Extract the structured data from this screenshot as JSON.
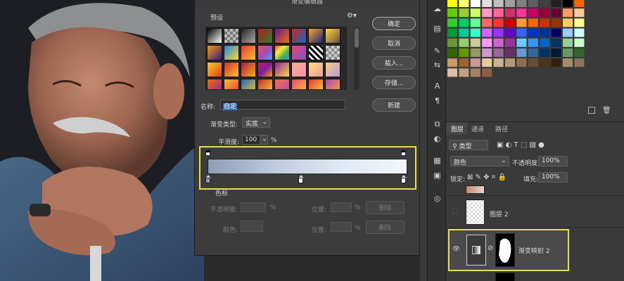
{
  "dialog": {
    "title": "渐变编辑器",
    "presets_label": "预设",
    "name_label": "名称:",
    "name_value": "自定",
    "gradient_type_label": "渐变类型:",
    "gradient_type_value": "实底",
    "smoothness_label": "平滑度:",
    "smoothness_value": "100",
    "smoothness_unit": "%",
    "stops_section_label": "色标",
    "opacity_label": "不透明度:",
    "opacity_unit": "%",
    "location_label": "位置:",
    "location_unit": "%",
    "delete_label": "删除",
    "color_label": "颜色:",
    "buttons": {
      "ok": "确定",
      "cancel": "取消",
      "load": "载入...",
      "save": "存储...",
      "new": "新建"
    },
    "gradient_colors": {
      "start": "#8d9db6",
      "end": "#f2f5fc"
    },
    "highlight_color": "#e6e04a"
  },
  "layers_panel": {
    "tabs": [
      "图层",
      "通道",
      "路径"
    ],
    "filter_kind": "类型",
    "blend_mode": "颜色",
    "opacity_label": "不透明度:",
    "opacity_value": "100%",
    "lock_label": "锁定:",
    "fill_label": "填充:",
    "fill_value": "100%",
    "layers": [
      {
        "name": ""
      },
      {
        "name": "图层 2"
      },
      {
        "name": "渐变映射 2"
      }
    ]
  }
}
